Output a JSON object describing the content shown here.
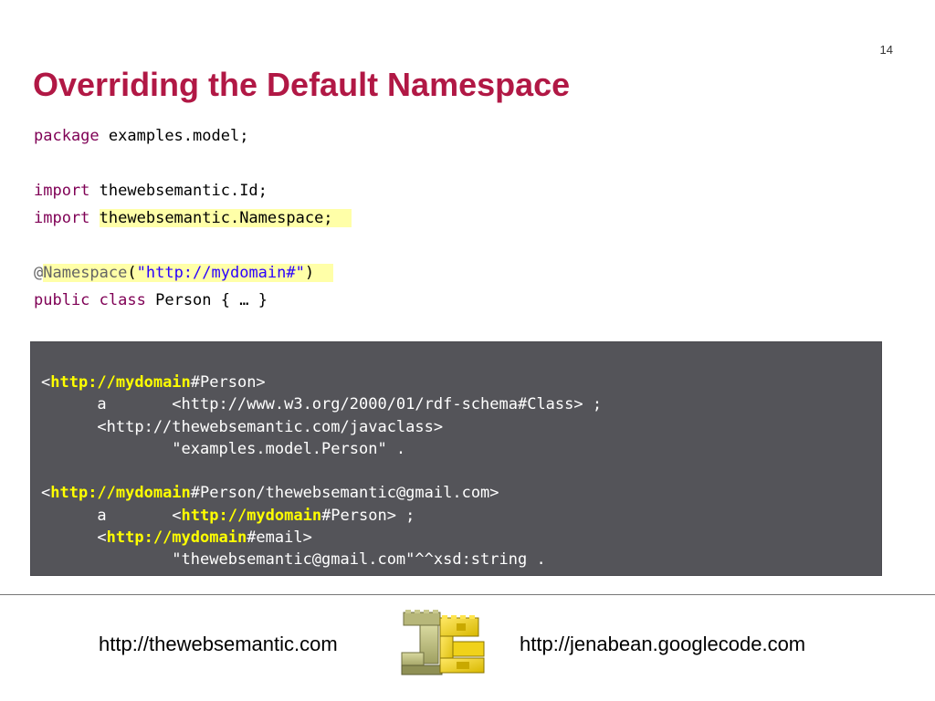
{
  "slide": {
    "page_number": "14",
    "title": "Overriding the Default Namespace"
  },
  "code": {
    "package_kw": "package",
    "package_name": "examples.model;",
    "import_kw_1": "import",
    "import_1": "thewebsemantic.Id;",
    "import_kw_2": "import",
    "import_2": "thewebsemantic.Namespace;",
    "annotation_at": "@",
    "annotation_name": "Namespace",
    "annotation_open": "(",
    "annotation_value": "\"http://mydomain#\"",
    "annotation_close": ")",
    "public_kw": "public",
    "class_kw": "class",
    "class_decl": "Person { … }"
  },
  "rdf": {
    "b1_open": "<",
    "b1_ns": "http://mydomain",
    "b1_rest": "#Person>",
    "b1_l2": "      a       <http://www.w3.org/2000/01/rdf-schema#Class> ;",
    "b1_l3": "      <http://thewebsemantic.com/javaclass>",
    "b1_l4": "              \"examples.model.Person\" .",
    "b2_open": "<",
    "b2_ns": "http://mydomain",
    "b2_rest": "#Person/thewebsemantic@gmail.com>",
    "b2_l2_pre": "      a       <",
    "b2_l2_ns": "http://mydomain",
    "b2_l2_rest": "#Person> ;",
    "b2_l3_pre": "      <",
    "b2_l3_ns": "http://mydomain",
    "b2_l3_rest": "#email>",
    "b2_l4": "              \"thewebsemantic@gmail.com\"^^xsd:string ."
  },
  "footer": {
    "left_link": "http://thewebsemantic.com",
    "right_link": "http://jenabean.googlecode.com",
    "logo_icon": "jb-logo-icon"
  },
  "colors": {
    "title": "#b11845",
    "keyword": "#7f0055",
    "string": "#2a00ff",
    "highlight": "#ffffa8",
    "panel_bg": "#545459",
    "panel_highlight": "#ffff00"
  }
}
